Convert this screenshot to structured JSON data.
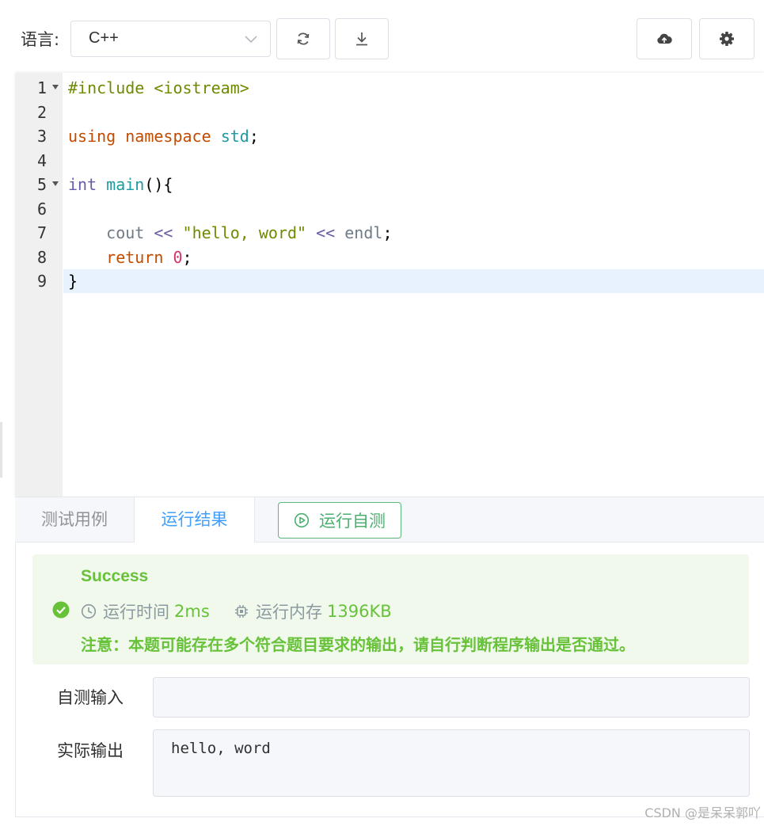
{
  "toolbar": {
    "language_label": "语言:",
    "language_selected": "C++"
  },
  "editor": {
    "lines": [
      {
        "no": "1",
        "foldable": true,
        "tokens": [
          {
            "t": "#include <iostream>",
            "c": "pp"
          }
        ]
      },
      {
        "no": "2",
        "foldable": false,
        "tokens": []
      },
      {
        "no": "3",
        "foldable": false,
        "tokens": [
          {
            "t": "using",
            "c": "kw"
          },
          {
            "t": " "
          },
          {
            "t": "namespace",
            "c": "kw"
          },
          {
            "t": " "
          },
          {
            "t": "std",
            "c": "ns"
          },
          {
            "t": ";"
          }
        ]
      },
      {
        "no": "4",
        "foldable": false,
        "tokens": []
      },
      {
        "no": "5",
        "foldable": true,
        "tokens": [
          {
            "t": "int",
            "c": "ty"
          },
          {
            "t": " "
          },
          {
            "t": "main",
            "c": "fn"
          },
          {
            "t": "(){"
          }
        ]
      },
      {
        "no": "6",
        "foldable": false,
        "tokens": []
      },
      {
        "no": "7",
        "foldable": false,
        "tokens": [
          {
            "t": "    "
          },
          {
            "t": "cout",
            "c": "id"
          },
          {
            "t": " "
          },
          {
            "t": "<<",
            "c": "op"
          },
          {
            "t": " "
          },
          {
            "t": "\"hello, word\"",
            "c": "str"
          },
          {
            "t": " "
          },
          {
            "t": "<<",
            "c": "op"
          },
          {
            "t": " "
          },
          {
            "t": "endl",
            "c": "id"
          },
          {
            "t": ";"
          }
        ]
      },
      {
        "no": "8",
        "foldable": false,
        "tokens": [
          {
            "t": "    "
          },
          {
            "t": "return",
            "c": "ret"
          },
          {
            "t": " "
          },
          {
            "t": "0",
            "c": "num"
          },
          {
            "t": ";"
          }
        ]
      },
      {
        "no": "9",
        "foldable": false,
        "active": true,
        "tokens": [
          {
            "t": "}"
          }
        ]
      }
    ]
  },
  "tabs": {
    "test_cases": "测试用例",
    "run_result": "运行结果",
    "run_self_test": "运行自测"
  },
  "result": {
    "status": "Success",
    "time_label": "运行时间",
    "time_value": "2ms",
    "memory_label": "运行内存",
    "memory_value": "1396KB",
    "notice": "注意：本题可能存在多个符合题目要求的输出，请自行判断程序输出是否通过。"
  },
  "io": {
    "input_label": "自测输入",
    "input_value": "",
    "output_label": "实际输出",
    "output_value": "hello, word"
  },
  "watermark": "CSDN @是呆呆郭吖",
  "colors": {
    "success": "#67c23a",
    "primary": "#409eff",
    "run_button": "#4caf6f"
  }
}
